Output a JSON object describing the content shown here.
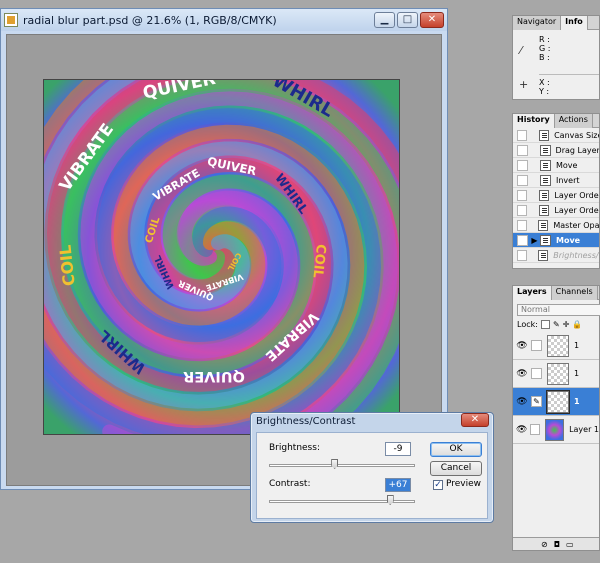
{
  "document": {
    "title": "radial blur part.psd @ 21.6% (1, RGB/8/CMYK)",
    "minimize": "▁",
    "maximize": "□",
    "close": "✕",
    "artwork_words": [
      "COIL",
      "VIBRATE",
      "QUIVER",
      "WHIRL"
    ]
  },
  "navigator_panel": {
    "tabs": [
      "Navigator",
      "Info"
    ],
    "active_tab": "Info",
    "rgb_labels": [
      "R :",
      "G :",
      "B :"
    ],
    "xy_labels": [
      "X :",
      "Y :"
    ],
    "eyedropper_icon": "eyedropper-icon",
    "crosshair_icon": "crosshair-icon"
  },
  "history_panel": {
    "tabs": [
      "History",
      "Actions"
    ],
    "active_tab": "History",
    "items": [
      {
        "label": "Canvas Size"
      },
      {
        "label": "Drag Layer"
      },
      {
        "label": "Move"
      },
      {
        "label": "Invert"
      },
      {
        "label": "Layer Order"
      },
      {
        "label": "Layer Order"
      },
      {
        "label": "Master Opac"
      },
      {
        "label": "Move"
      },
      {
        "label": "Brightness/C"
      }
    ],
    "selected_index": 7,
    "disabled_index": 8
  },
  "layers_panel": {
    "tabs": [
      "Layers",
      "Channels"
    ],
    "active_tab": "Layers",
    "blend_mode": "Normal",
    "lock_label": "Lock:",
    "layers": [
      {
        "name": "1"
      },
      {
        "name": "1"
      },
      {
        "name": "1"
      },
      {
        "name": "Layer 1"
      }
    ],
    "selected_index": 2
  },
  "bc_dialog": {
    "title": "Brightness/Contrast",
    "close": "✕",
    "brightness_label": "Brightness:",
    "brightness_value": "-9",
    "brightness_fraction": 0.45,
    "contrast_label": "Contrast:",
    "contrast_value": "+67",
    "contrast_fraction": 0.83,
    "ok_label": "OK",
    "cancel_label": "Cancel",
    "preview_label": "Preview",
    "preview_checked": true,
    "check_glyph": "✓"
  }
}
